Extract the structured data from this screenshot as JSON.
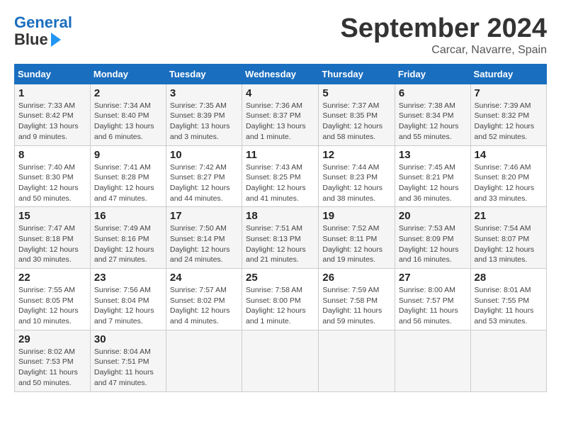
{
  "header": {
    "logo_line1": "General",
    "logo_line2": "Blue",
    "month_title": "September 2024",
    "subtitle": "Carcar, Navarre, Spain"
  },
  "days_of_week": [
    "Sunday",
    "Monday",
    "Tuesday",
    "Wednesday",
    "Thursday",
    "Friday",
    "Saturday"
  ],
  "weeks": [
    [
      {
        "day": "1",
        "detail": "Sunrise: 7:33 AM\nSunset: 8:42 PM\nDaylight: 13 hours\nand 9 minutes."
      },
      {
        "day": "2",
        "detail": "Sunrise: 7:34 AM\nSunset: 8:40 PM\nDaylight: 13 hours\nand 6 minutes."
      },
      {
        "day": "3",
        "detail": "Sunrise: 7:35 AM\nSunset: 8:39 PM\nDaylight: 13 hours\nand 3 minutes."
      },
      {
        "day": "4",
        "detail": "Sunrise: 7:36 AM\nSunset: 8:37 PM\nDaylight: 13 hours\nand 1 minute."
      },
      {
        "day": "5",
        "detail": "Sunrise: 7:37 AM\nSunset: 8:35 PM\nDaylight: 12 hours\nand 58 minutes."
      },
      {
        "day": "6",
        "detail": "Sunrise: 7:38 AM\nSunset: 8:34 PM\nDaylight: 12 hours\nand 55 minutes."
      },
      {
        "day": "7",
        "detail": "Sunrise: 7:39 AM\nSunset: 8:32 PM\nDaylight: 12 hours\nand 52 minutes."
      }
    ],
    [
      {
        "day": "8",
        "detail": "Sunrise: 7:40 AM\nSunset: 8:30 PM\nDaylight: 12 hours\nand 50 minutes."
      },
      {
        "day": "9",
        "detail": "Sunrise: 7:41 AM\nSunset: 8:28 PM\nDaylight: 12 hours\nand 47 minutes."
      },
      {
        "day": "10",
        "detail": "Sunrise: 7:42 AM\nSunset: 8:27 PM\nDaylight: 12 hours\nand 44 minutes."
      },
      {
        "day": "11",
        "detail": "Sunrise: 7:43 AM\nSunset: 8:25 PM\nDaylight: 12 hours\nand 41 minutes."
      },
      {
        "day": "12",
        "detail": "Sunrise: 7:44 AM\nSunset: 8:23 PM\nDaylight: 12 hours\nand 38 minutes."
      },
      {
        "day": "13",
        "detail": "Sunrise: 7:45 AM\nSunset: 8:21 PM\nDaylight: 12 hours\nand 36 minutes."
      },
      {
        "day": "14",
        "detail": "Sunrise: 7:46 AM\nSunset: 8:20 PM\nDaylight: 12 hours\nand 33 minutes."
      }
    ],
    [
      {
        "day": "15",
        "detail": "Sunrise: 7:47 AM\nSunset: 8:18 PM\nDaylight: 12 hours\nand 30 minutes."
      },
      {
        "day": "16",
        "detail": "Sunrise: 7:49 AM\nSunset: 8:16 PM\nDaylight: 12 hours\nand 27 minutes."
      },
      {
        "day": "17",
        "detail": "Sunrise: 7:50 AM\nSunset: 8:14 PM\nDaylight: 12 hours\nand 24 minutes."
      },
      {
        "day": "18",
        "detail": "Sunrise: 7:51 AM\nSunset: 8:13 PM\nDaylight: 12 hours\nand 21 minutes."
      },
      {
        "day": "19",
        "detail": "Sunrise: 7:52 AM\nSunset: 8:11 PM\nDaylight: 12 hours\nand 19 minutes."
      },
      {
        "day": "20",
        "detail": "Sunrise: 7:53 AM\nSunset: 8:09 PM\nDaylight: 12 hours\nand 16 minutes."
      },
      {
        "day": "21",
        "detail": "Sunrise: 7:54 AM\nSunset: 8:07 PM\nDaylight: 12 hours\nand 13 minutes."
      }
    ],
    [
      {
        "day": "22",
        "detail": "Sunrise: 7:55 AM\nSunset: 8:05 PM\nDaylight: 12 hours\nand 10 minutes."
      },
      {
        "day": "23",
        "detail": "Sunrise: 7:56 AM\nSunset: 8:04 PM\nDaylight: 12 hours\nand 7 minutes."
      },
      {
        "day": "24",
        "detail": "Sunrise: 7:57 AM\nSunset: 8:02 PM\nDaylight: 12 hours\nand 4 minutes."
      },
      {
        "day": "25",
        "detail": "Sunrise: 7:58 AM\nSunset: 8:00 PM\nDaylight: 12 hours\nand 1 minute."
      },
      {
        "day": "26",
        "detail": "Sunrise: 7:59 AM\nSunset: 7:58 PM\nDaylight: 11 hours\nand 59 minutes."
      },
      {
        "day": "27",
        "detail": "Sunrise: 8:00 AM\nSunset: 7:57 PM\nDaylight: 11 hours\nand 56 minutes."
      },
      {
        "day": "28",
        "detail": "Sunrise: 8:01 AM\nSunset: 7:55 PM\nDaylight: 11 hours\nand 53 minutes."
      }
    ],
    [
      {
        "day": "29",
        "detail": "Sunrise: 8:02 AM\nSunset: 7:53 PM\nDaylight: 11 hours\nand 50 minutes."
      },
      {
        "day": "30",
        "detail": "Sunrise: 8:04 AM\nSunset: 7:51 PM\nDaylight: 11 hours\nand 47 minutes."
      },
      {
        "day": "",
        "detail": ""
      },
      {
        "day": "",
        "detail": ""
      },
      {
        "day": "",
        "detail": ""
      },
      {
        "day": "",
        "detail": ""
      },
      {
        "day": "",
        "detail": ""
      }
    ]
  ]
}
